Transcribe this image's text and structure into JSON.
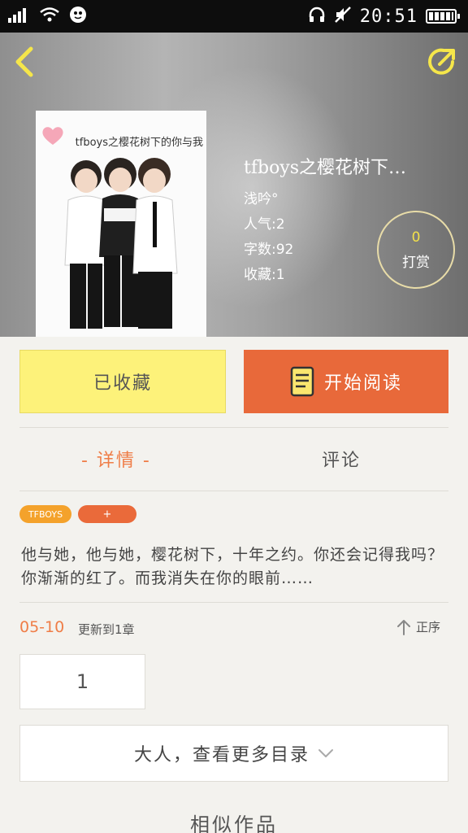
{
  "status_bar": {
    "time": "20:51"
  },
  "book": {
    "cover_caption": "tfboys之樱花树下的你与我",
    "title": "tfboys之樱花树下…",
    "author": "浅吟°",
    "popularity": "人气:2",
    "word_count": "字数:92",
    "favorites": "收藏:1"
  },
  "reward": {
    "count": "0",
    "label": "打赏"
  },
  "actions": {
    "collected_label": "已收藏",
    "read_label": "开始阅读"
  },
  "tabs": {
    "details": "- 详情 -",
    "comments": "评论"
  },
  "tags": [
    "TFBOYS",
    "+"
  ],
  "summary": "他与她，他与她，樱花树下，十年之约。你还会记得我吗？你渐渐的红了。而我消失在你的眼前……",
  "update": {
    "date": "05-10",
    "text": "更新到1章",
    "sort_label": "正序"
  },
  "chapter_box": "1",
  "more_catalog": "大人，查看更多目录",
  "similar_title": "相似作品",
  "colors": {
    "accent_orange": "#e8693a",
    "tag_orange": "#f4a22b",
    "collected_yellow": "#fdf27a",
    "icon_yellow": "#f5e64a"
  }
}
